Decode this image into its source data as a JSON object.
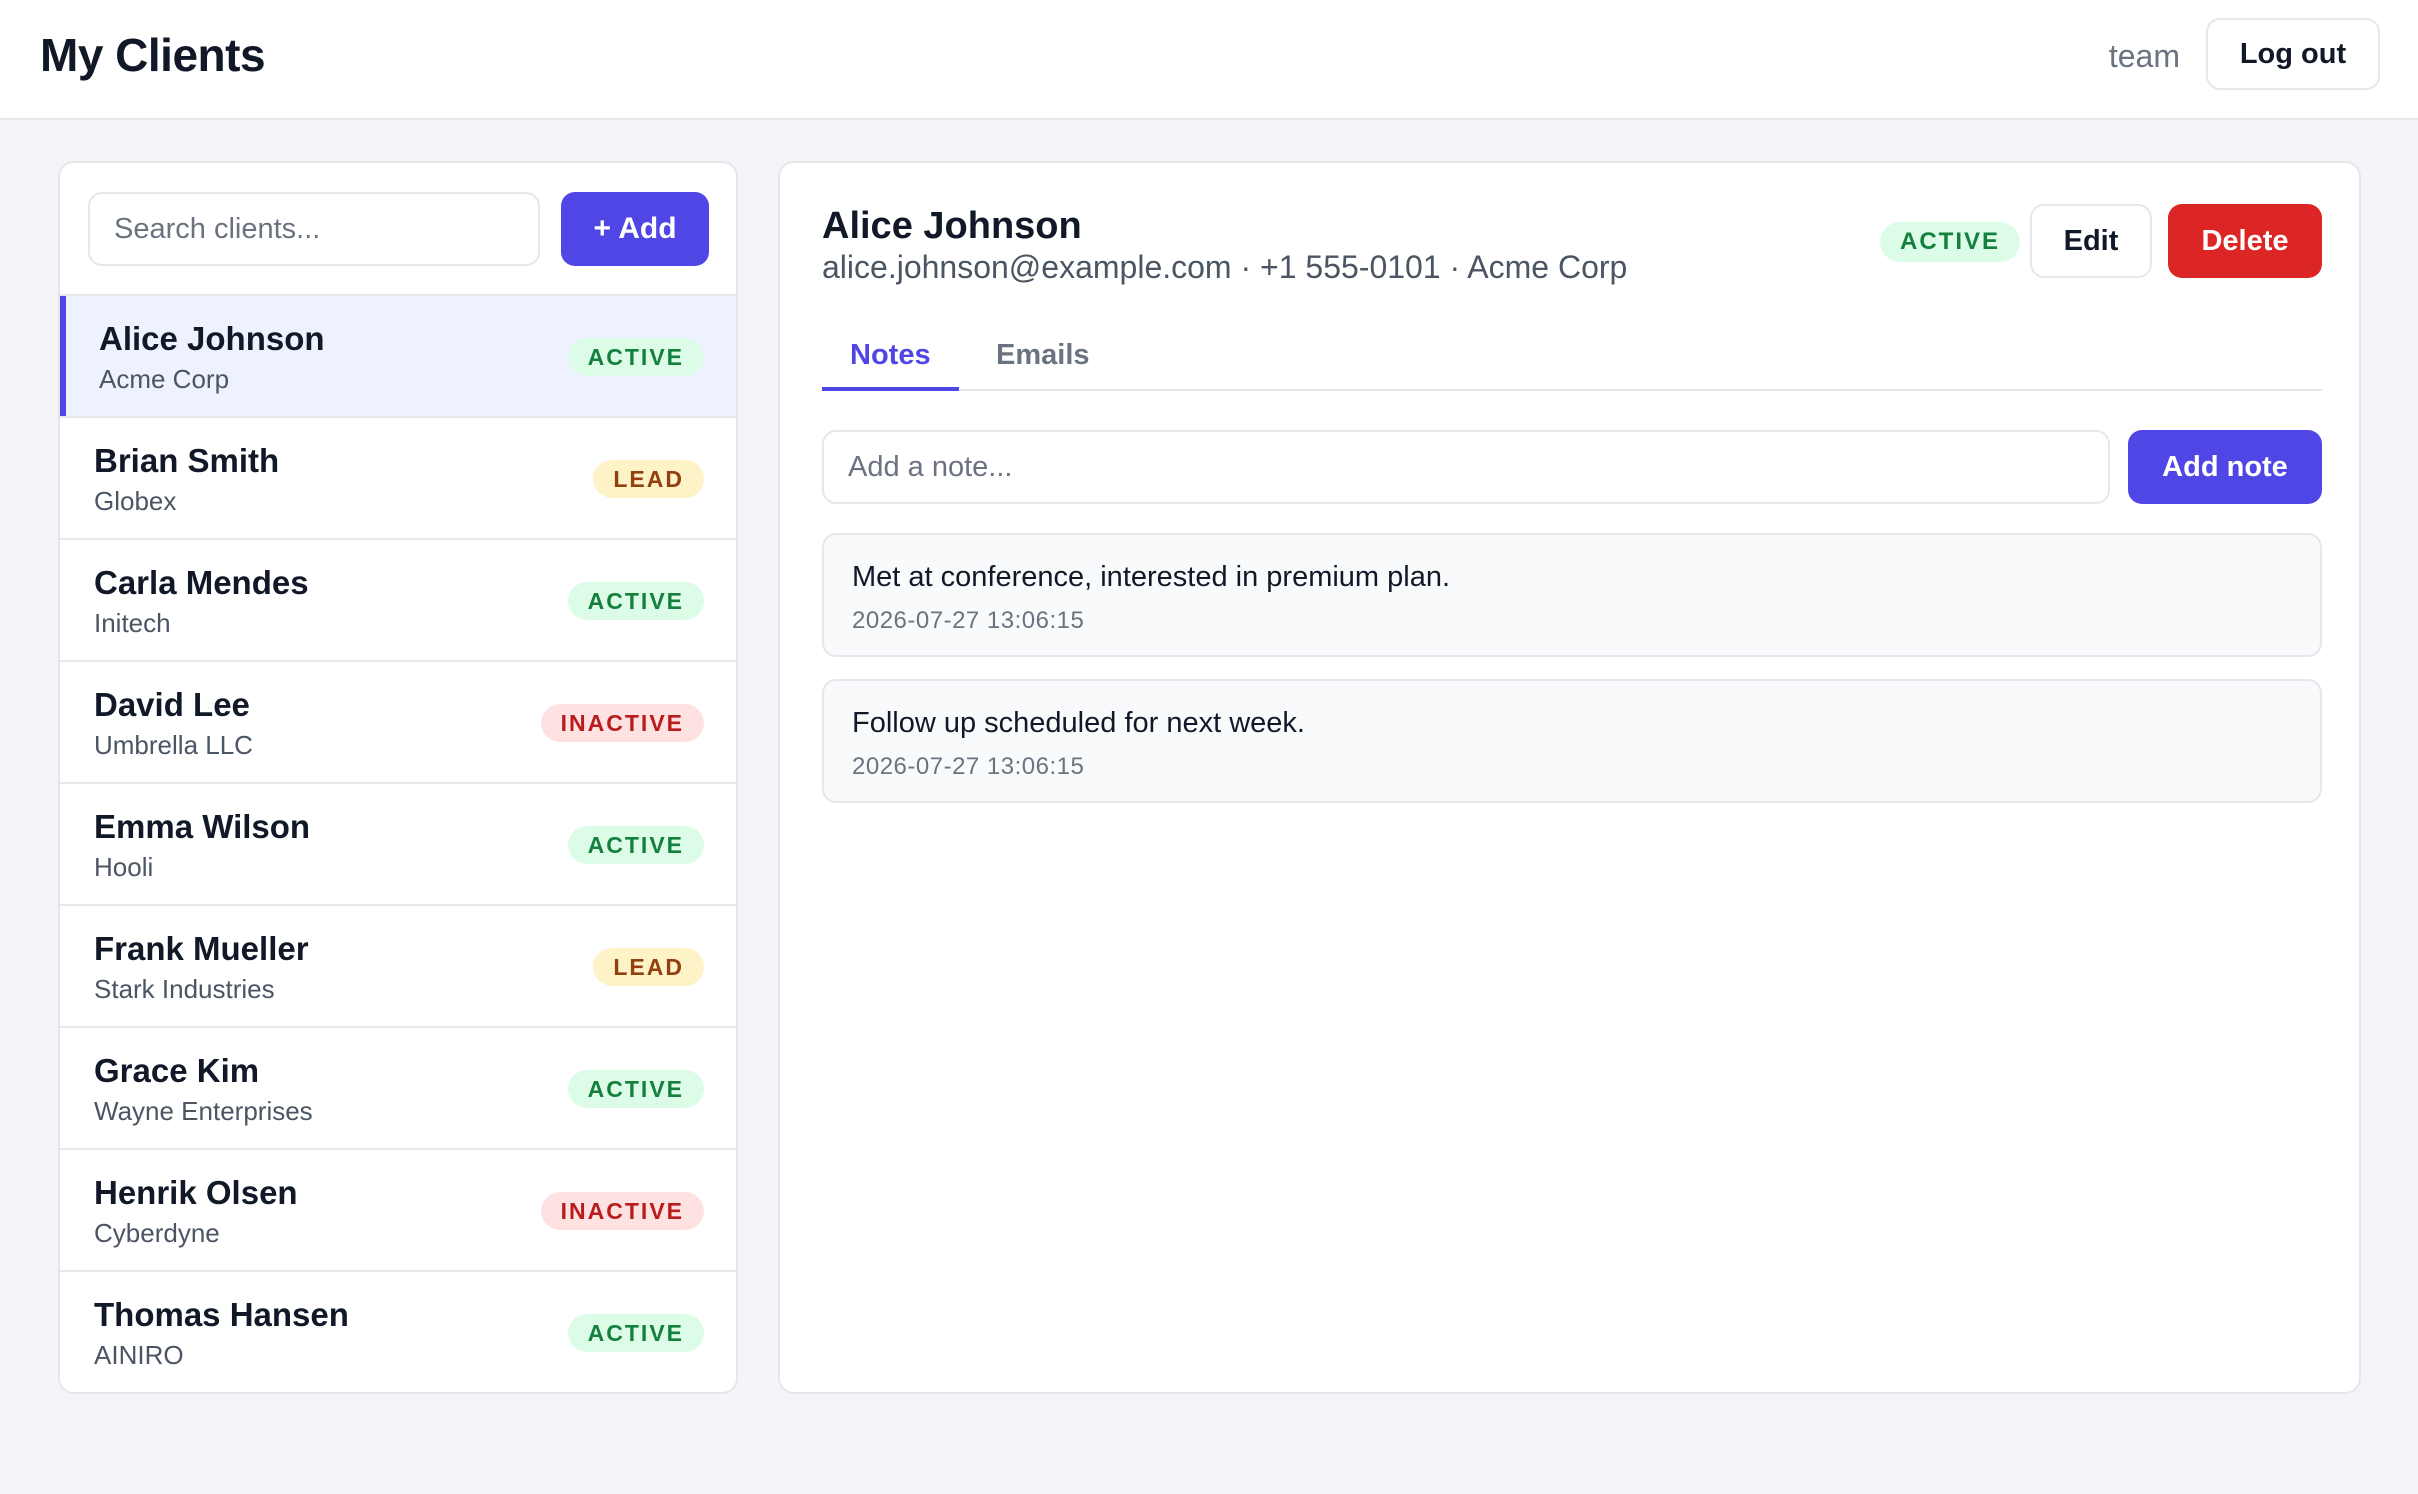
{
  "header": {
    "title": "My Clients",
    "username": "team",
    "logout_label": "Log out"
  },
  "sidebar": {
    "search_placeholder": "Search clients...",
    "search_value": "",
    "add_label": "+ Add",
    "clients": [
      {
        "name": "Alice Johnson",
        "company": "Acme Corp",
        "status": "ACTIVE",
        "status_kind": "active",
        "selected": true
      },
      {
        "name": "Brian Smith",
        "company": "Globex",
        "status": "LEAD",
        "status_kind": "lead",
        "selected": false
      },
      {
        "name": "Carla Mendes",
        "company": "Initech",
        "status": "ACTIVE",
        "status_kind": "active",
        "selected": false
      },
      {
        "name": "David Lee",
        "company": "Umbrella LLC",
        "status": "INACTIVE",
        "status_kind": "inactive",
        "selected": false
      },
      {
        "name": "Emma Wilson",
        "company": "Hooli",
        "status": "ACTIVE",
        "status_kind": "active",
        "selected": false
      },
      {
        "name": "Frank Mueller",
        "company": "Stark Industries",
        "status": "LEAD",
        "status_kind": "lead",
        "selected": false
      },
      {
        "name": "Grace Kim",
        "company": "Wayne Enterprises",
        "status": "ACTIVE",
        "status_kind": "active",
        "selected": false
      },
      {
        "name": "Henrik Olsen",
        "company": "Cyberdyne",
        "status": "INACTIVE",
        "status_kind": "inactive",
        "selected": false
      },
      {
        "name": "Thomas Hansen",
        "company": "AINIRO",
        "status": "ACTIVE",
        "status_kind": "active",
        "selected": false
      }
    ]
  },
  "detail": {
    "name": "Alice Johnson",
    "meta": "alice.johnson@example.com · +1 555-0101 · Acme Corp",
    "status": "ACTIVE",
    "edit_label": "Edit",
    "delete_label": "Delete",
    "tabs": [
      {
        "label": "Notes",
        "active": true
      },
      {
        "label": "Emails",
        "active": false
      }
    ],
    "note_placeholder": "Add a note...",
    "note_value": "",
    "add_note_label": "Add note",
    "notes": [
      {
        "text": "Met at conference, interested in premium plan.",
        "time": "2026-07-27 13:06:15"
      },
      {
        "text": "Follow up scheduled for next week.",
        "time": "2026-07-27 13:06:15"
      }
    ]
  },
  "colors": {
    "accent": "#4f46e5",
    "danger": "#dc2626",
    "active_bg": "#dcfce7",
    "active_fg": "#15803d",
    "lead_bg": "#fef3c7",
    "lead_fg": "#92400e",
    "inactive_bg": "#fee2e2",
    "inactive_fg": "#b91c1c"
  }
}
